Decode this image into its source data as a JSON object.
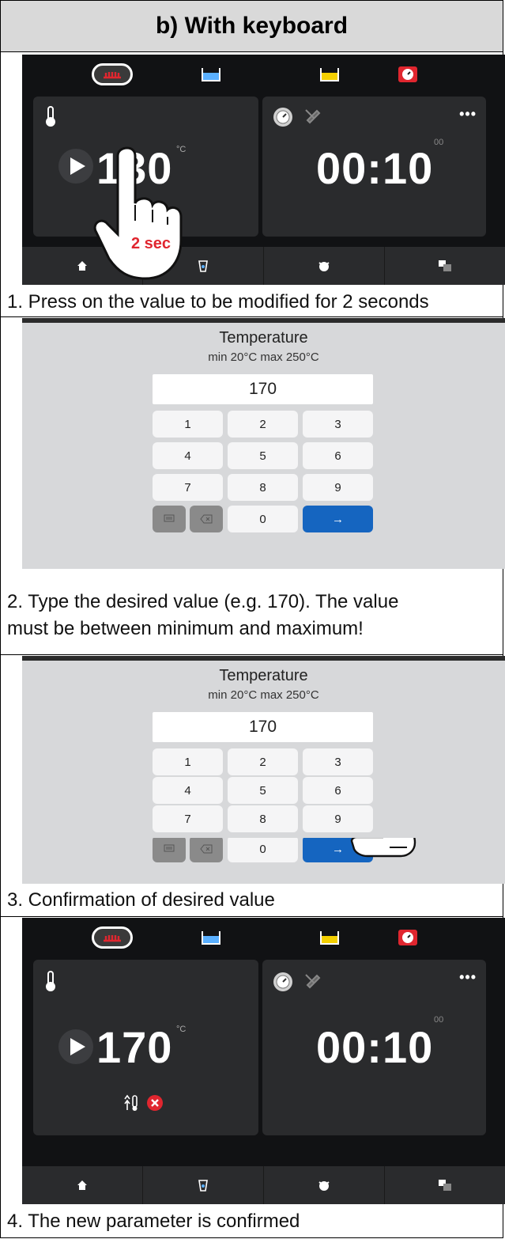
{
  "header": {
    "title": "b)  With keyboard"
  },
  "screens": {
    "s1": {
      "temperature": "130",
      "unit": "°C",
      "timer": "00:10",
      "timer_small": "00",
      "press_label": "2 sec"
    },
    "s4": {
      "temperature": "170",
      "unit": "°C",
      "timer": "00:10",
      "timer_small": "00"
    }
  },
  "keypad": {
    "title": "Temperature",
    "range": "min 20°C max 250°C",
    "value": "170",
    "keys": [
      "1",
      "2",
      "3",
      "4",
      "5",
      "6",
      "7",
      "8",
      "9",
      "0"
    ],
    "enter_symbol": "→"
  },
  "captions": {
    "step1": "1. Press on the value to be modified for 2 seconds",
    "step2_line1": "2. Type the desired value (e.g. 170). The value",
    "step2_line2": "must be between minimum and maximum!",
    "step3": "3. Confirmation of desired value",
    "step4": "4. The new parameter is confirmed"
  },
  "icons": {
    "topbar": [
      "grill-icon",
      "water-bath-icon",
      "oil-fryer-icon",
      "timer-device-icon"
    ],
    "bottombar": [
      "home-icon",
      "rinse-icon",
      "chef-icon",
      "language-icon"
    ]
  },
  "colors": {
    "accent_blue": "#1565c0",
    "alert_red": "#e0262f",
    "press_red": "#e0262f",
    "oil_yellow": "#f4d000"
  }
}
